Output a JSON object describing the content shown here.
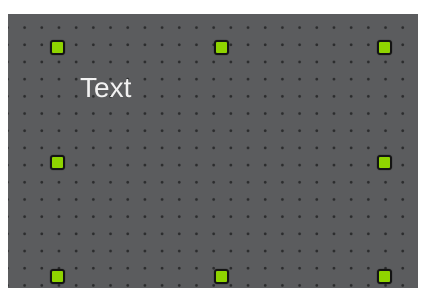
{
  "canvas": {
    "text_element": {
      "content": "Text"
    }
  },
  "colors": {
    "canvas_background": "#5b5c5e",
    "grid_dots": "#2b2c2d",
    "handle_fill": "#8fd400",
    "handle_border": "#141414",
    "text": "#f2f2f2"
  }
}
